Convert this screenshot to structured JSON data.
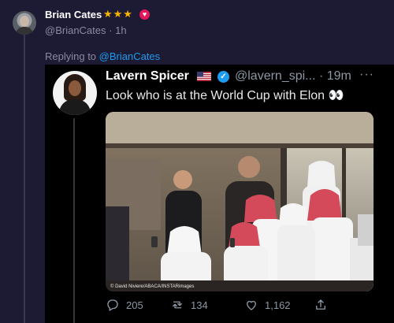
{
  "parent": {
    "name": "Brian Cates",
    "stars": "★★★",
    "handle": "@BrianCates",
    "time": "1h"
  },
  "replying": {
    "prefix": "Replying to ",
    "handle": "@BrianCates"
  },
  "tweet": {
    "name": "Lavern Spicer",
    "handle": "@lavern_spi...",
    "time": "19m",
    "text": "Look who is at the World Cup with Elon 👀",
    "more": "···",
    "photo_credit": "© David Niviere/ABACA/INSTARimages",
    "replies": "205",
    "retweets": "134",
    "likes": "1,162"
  },
  "colors": {
    "background": "#1d1a33",
    "card": "#000000",
    "link": "#1d9bf0",
    "stars": "#f4b400",
    "verified": "#1d9bf0"
  }
}
